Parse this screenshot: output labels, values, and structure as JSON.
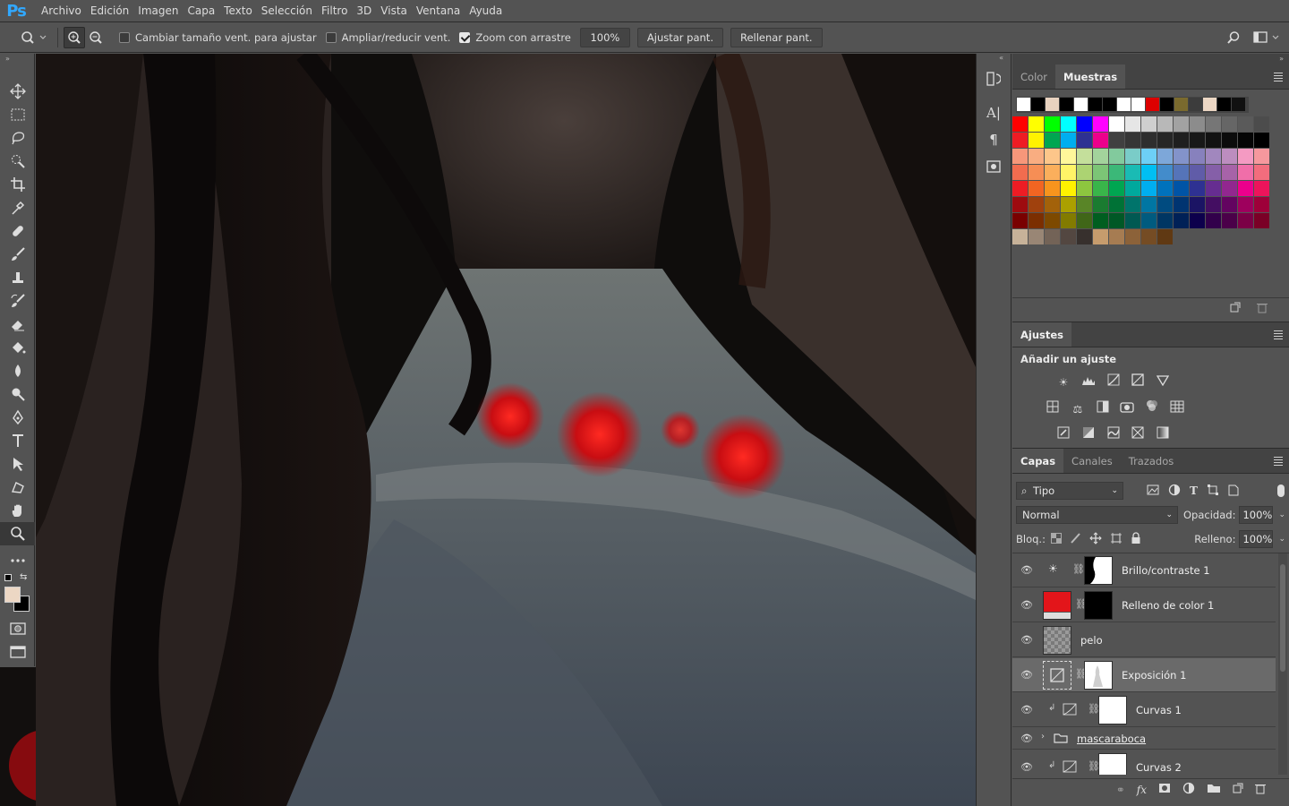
{
  "app": {
    "logo": "Ps"
  },
  "menu": [
    "Archivo",
    "Edición",
    "Imagen",
    "Capa",
    "Texto",
    "Selección",
    "Filtro",
    "3D",
    "Vista",
    "Ventana",
    "Ayuda"
  ],
  "options": {
    "resize_windows": {
      "label": "Cambiar tamaño vent. para ajustar",
      "checked": false
    },
    "zoom_all": {
      "label": "Ampliar/reducir vent.",
      "checked": false
    },
    "scrubby_zoom": {
      "label": "Zoom con arrastre",
      "checked": true
    },
    "zoom_value": "100%",
    "fit_screen": "Ajustar pant.",
    "fill_screen": "Rellenar pant."
  },
  "tools": [
    "move-tool",
    "marquee-tool",
    "lasso-tool",
    "quick-select-tool",
    "crop-tool",
    "eyedropper-tool",
    "healing-brush-tool",
    "brush-tool",
    "clone-stamp-tool",
    "history-brush-tool",
    "eraser-tool",
    "paint-bucket-tool",
    "blur-tool",
    "dodge-tool",
    "pen-tool",
    "type-tool",
    "path-select-tool",
    "shape-tool",
    "hand-tool",
    "zoom-tool",
    "more-tools"
  ],
  "color_panel": {
    "tabs": [
      "Color",
      "Muestras"
    ],
    "active_tab": "Muestras",
    "recent": [
      "#ffffff",
      "#000000",
      "#e8d2bf",
      "#000000",
      "#ffffff",
      "#000000",
      "#000000",
      "#ffffff",
      "#ffffff",
      "#dd0000",
      "#000000",
      "#7a6a2e",
      "#3c3c3c",
      "#ecd7c4",
      "#000000",
      "#111111"
    ],
    "rows": [
      [
        "#ff0000",
        "#ffff00",
        "#00ff00",
        "#00ffff",
        "#0000ff",
        "#ff00ff",
        "#ffffff",
        "#e6e6e6",
        "#cfcfcf",
        "#b8b8b8",
        "#a2a2a2",
        "#8c8c8c",
        "#767676",
        "#666666",
        "#5a5a5a",
        "#4c4c4c"
      ],
      [
        "#ee1c24",
        "#fff200",
        "#00a651",
        "#00aeef",
        "#2e3192",
        "#ec008c",
        "#404040",
        "#363636",
        "#2e2e2e",
        "#262626",
        "#1f1f1f",
        "#181818",
        "#121212",
        "#0c0c0c",
        "#050505",
        "#000000"
      ],
      [
        "#f7977a",
        "#f9ad81",
        "#fdc68a",
        "#fff79a",
        "#c4df9b",
        "#a3d39c",
        "#82ca9d",
        "#7accc8",
        "#6dcff6",
        "#7da7d9",
        "#8393ca",
        "#8781bd",
        "#a187be",
        "#bc8dbf",
        "#f49ac2",
        "#f6989d"
      ],
      [
        "#f26c4f",
        "#f68e55",
        "#fbaf5c",
        "#fff467",
        "#acd372",
        "#7cc576",
        "#3bb878",
        "#1abbb4",
        "#00bff3",
        "#438ccb",
        "#5574b9",
        "#605ca8",
        "#855fa8",
        "#a763a8",
        "#f06ea9",
        "#f26d7d"
      ],
      [
        "#ed1c24",
        "#f26522",
        "#f7941d",
        "#fff200",
        "#8dc63f",
        "#39b54a",
        "#00a651",
        "#00a99d",
        "#00aeef",
        "#0072bc",
        "#0054a6",
        "#2e3192",
        "#662d91",
        "#92278f",
        "#ec008c",
        "#ed145b"
      ],
      [
        "#9e0b0f",
        "#a0410d",
        "#a3620a",
        "#aba000",
        "#598527",
        "#1a7b30",
        "#007236",
        "#00746b",
        "#0076a3",
        "#004b80",
        "#003471",
        "#1b1464",
        "#440e62",
        "#630460",
        "#9e005d",
        "#9e0039"
      ],
      [
        "#790000",
        "#7b2e00",
        "#7d4900",
        "#827b00",
        "#406618",
        "#005e20",
        "#005826",
        "#005952",
        "#005b7f",
        "#003663",
        "#002157",
        "#0d004c",
        "#32004b",
        "#4b0049",
        "#7b0046",
        "#7a0026"
      ],
      [
        "#c7b299",
        "#998675",
        "#736357",
        "#534741",
        "#37302d",
        "#c69c6d",
        "#a67c52",
        "#8c6239",
        "#754c24",
        "#603913"
      ]
    ]
  },
  "adjustments": {
    "tab": "Ajustes",
    "heading": "Añadir un ajuste"
  },
  "layers_panel": {
    "tabs": [
      "Capas",
      "Canales",
      "Trazados"
    ],
    "active_tab": "Capas",
    "filter": "Tipo",
    "blend_mode": "Normal",
    "opacity_label": "Opacidad:",
    "opacity": "100%",
    "lock_label": "Bloq.:",
    "fill_label": "Relleno:",
    "fill": "100%",
    "layers": [
      {
        "name": "Brillo/contraste 1",
        "type": "brightness-adjustment",
        "selected": false
      },
      {
        "name": "Relleno de color 1",
        "type": "color-fill",
        "selected": false
      },
      {
        "name": "pelo",
        "type": "pixel",
        "selected": false
      },
      {
        "name": "Exposición 1",
        "type": "exposure-adjustment",
        "selected": true
      },
      {
        "name": "Curvas 1",
        "type": "curves-adjustment",
        "selected": false
      },
      {
        "name": "mascaraboca",
        "type": "group",
        "selected": false
      },
      {
        "name": "Curvas 2",
        "type": "curves-adjustment",
        "selected": false
      }
    ]
  },
  "colors": {
    "foreground": "#ecd7c4",
    "background": "#000000",
    "fill_red": "#e3151a"
  }
}
